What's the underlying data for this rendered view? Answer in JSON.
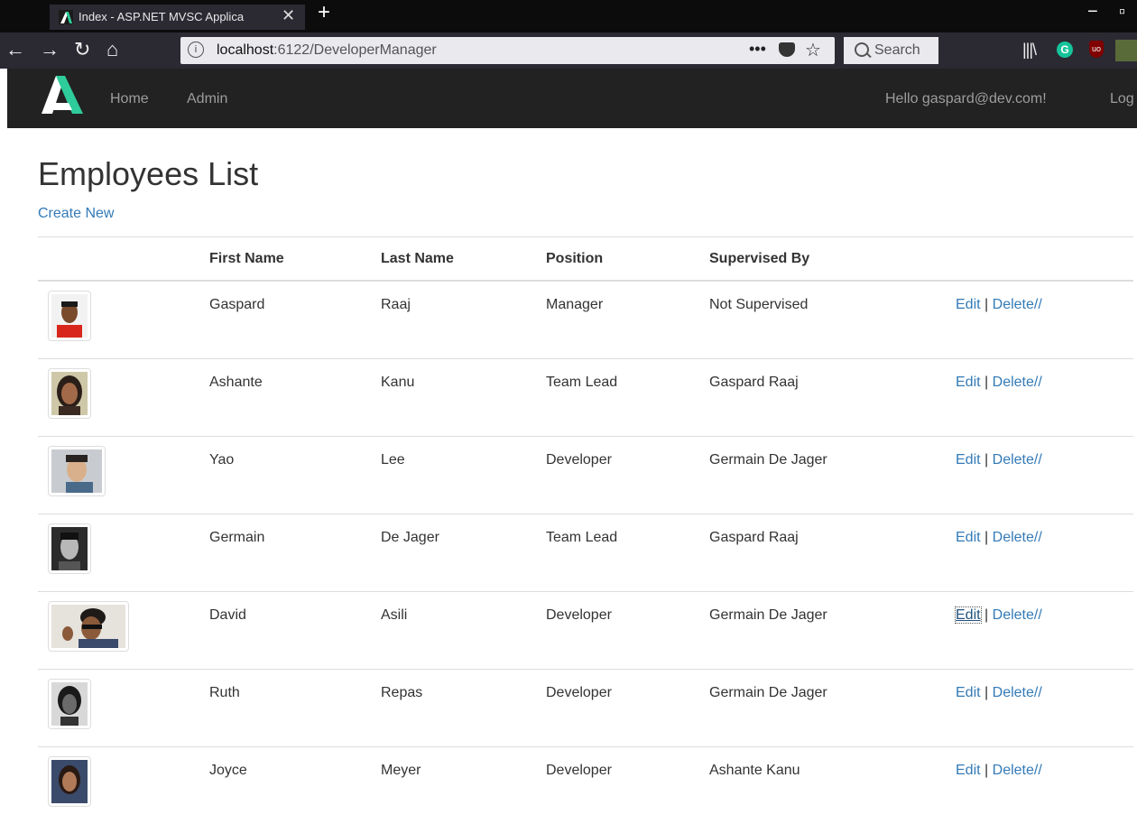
{
  "browser": {
    "tab_title": "Index - ASP.NET MVSC Applica",
    "new_tab_symbol": "+",
    "url_host": "localhost",
    "url_path": ":6122/DeveloperManager",
    "search_placeholder": "Search",
    "more_symbol": "•••"
  },
  "navbar": {
    "home": "Home",
    "admin": "Admin",
    "greeting": "Hello gaspard@dev.com!",
    "logout": "Log"
  },
  "page": {
    "title": "Employees List",
    "create_new": "Create New"
  },
  "table": {
    "headers": [
      "",
      "First Name",
      "Last Name",
      "Position",
      "Supervised By",
      ""
    ],
    "rows": [
      {
        "first": "Gaspard",
        "last": "Raaj",
        "position": "Manager",
        "supervisor": "Not Supervised"
      },
      {
        "first": "Ashante",
        "last": "Kanu",
        "position": "Team Lead",
        "supervisor": "Gaspard Raaj"
      },
      {
        "first": "Yao",
        "last": "Lee",
        "position": "Developer",
        "supervisor": "Germain De Jager"
      },
      {
        "first": "Germain",
        "last": "De Jager",
        "position": "Team Lead",
        "supervisor": "Gaspard Raaj"
      },
      {
        "first": "David",
        "last": "Asili",
        "position": "Developer",
        "supervisor": "Germain De Jager"
      },
      {
        "first": "Ruth",
        "last": "Repas",
        "position": "Developer",
        "supervisor": "Germain De Jager"
      },
      {
        "first": "Joyce",
        "last": "Meyer",
        "position": "Developer",
        "supervisor": "Ashante Kanu"
      }
    ],
    "edit_label": "Edit",
    "separator": "|",
    "delete_label": "Delete",
    "trailing": "//"
  },
  "colors": {
    "link": "#337ab7",
    "navbar_bg": "#222222",
    "logo_accent": "#2ecc9a"
  }
}
